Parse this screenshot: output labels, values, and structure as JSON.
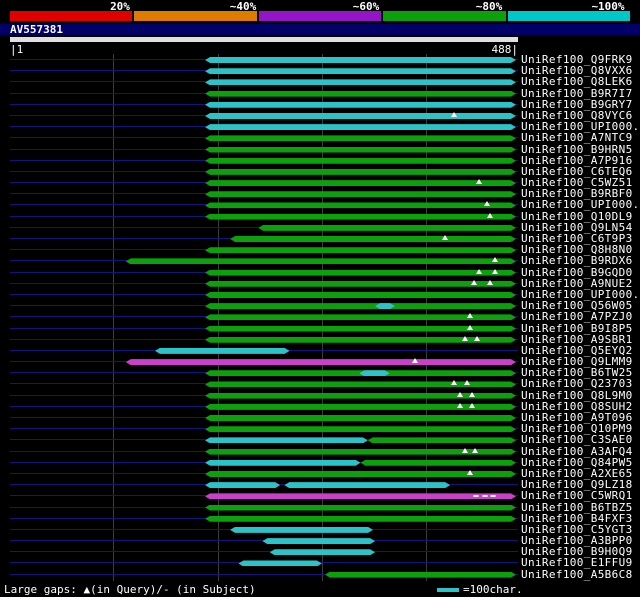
{
  "colors": {
    "cyan": "#2bc3c7",
    "green": "#0ca00c",
    "magenta": "#cc3fcc",
    "baseline": "#14147e",
    "grid": "#3c3c3c",
    "query_strip": "#000066",
    "query_bar": "#e0e0e0"
  },
  "query": {
    "name": "AV557381",
    "start_label": "|1",
    "end_label": "488|",
    "length": 488
  },
  "footer": {
    "gaps_label": "Large gaps: ▲(in Query)/- (in Subject)",
    "legend_text": "=100char."
  },
  "chart_data": {
    "type": "bar",
    "title": "AV557381",
    "x_axis": {
      "min": 1,
      "max": 488,
      "gridlines": [
        100,
        200,
        300,
        400
      ]
    },
    "legend": {
      "labels": [
        "20%",
        "~40%",
        "~60%",
        "~80%",
        "~100%"
      ],
      "colors": [
        "#e00000",
        "#de7b00",
        "#9414c8",
        "#0ca00c",
        "#00c8c8"
      ]
    },
    "rows": [
      {
        "label": "UniRef100_Q9FRK9",
        "segments": [
          {
            "start": 188,
            "end": 486,
            "color": "cyan"
          }
        ]
      },
      {
        "label": "UniRef100_Q8VXX6",
        "segments": [
          {
            "start": 188,
            "end": 486,
            "color": "cyan"
          }
        ]
      },
      {
        "label": "UniRef100_Q8LEK6",
        "segments": [
          {
            "start": 188,
            "end": 486,
            "color": "cyan"
          }
        ]
      },
      {
        "label": "UniRef100_B9R7I7",
        "segments": [
          {
            "start": 188,
            "end": 486,
            "color": "green"
          }
        ]
      },
      {
        "label": "UniRef100_B9GRY7",
        "segments": [
          {
            "start": 188,
            "end": 486,
            "color": "cyan"
          }
        ]
      },
      {
        "label": "UniRef100_Q8VYC6",
        "segments": [
          {
            "start": 188,
            "end": 486,
            "color": "cyan",
            "ticks": [
              427
            ]
          }
        ]
      },
      {
        "label": "UniRef100_UPI000..",
        "segments": [
          {
            "start": 188,
            "end": 486,
            "color": "cyan"
          }
        ]
      },
      {
        "label": "UniRef100_A7NTC9",
        "segments": [
          {
            "start": 188,
            "end": 486,
            "color": "green"
          }
        ]
      },
      {
        "label": "UniRef100_B9HRN5",
        "segments": [
          {
            "start": 188,
            "end": 486,
            "color": "green"
          }
        ]
      },
      {
        "label": "UniRef100_A7P916",
        "segments": [
          {
            "start": 188,
            "end": 486,
            "color": "green"
          }
        ]
      },
      {
        "label": "UniRef100_C6TEQ6",
        "segments": [
          {
            "start": 188,
            "end": 486,
            "color": "green"
          }
        ]
      },
      {
        "label": "UniRef100_C5WZ51",
        "segments": [
          {
            "start": 188,
            "end": 486,
            "color": "green",
            "ticks": [
              451
            ]
          }
        ]
      },
      {
        "label": "UniRef100_B9RBF0",
        "segments": [
          {
            "start": 188,
            "end": 486,
            "color": "green"
          }
        ]
      },
      {
        "label": "UniRef100_UPI000..",
        "segments": [
          {
            "start": 188,
            "end": 486,
            "color": "green",
            "ticks": [
              458
            ]
          }
        ]
      },
      {
        "label": "UniRef100_Q10DL9",
        "segments": [
          {
            "start": 188,
            "end": 486,
            "color": "green",
            "ticks": [
              461
            ]
          }
        ]
      },
      {
        "label": "UniRef100_Q9LN54",
        "segments": [
          {
            "start": 239,
            "end": 486,
            "color": "green"
          }
        ]
      },
      {
        "label": "UniRef100_C6T9P3",
        "segments": [
          {
            "start": 212,
            "end": 486,
            "color": "green",
            "ticks": [
              418
            ]
          }
        ]
      },
      {
        "label": "UniRef100_Q8H8N0",
        "segments": [
          {
            "start": 188,
            "end": 486,
            "color": "green"
          }
        ]
      },
      {
        "label": "UniRef100_B9RDX6",
        "segments": [
          {
            "start": 112,
            "end": 486,
            "color": "green",
            "ticks": [
              466
            ]
          }
        ]
      },
      {
        "label": "UniRef100_B9GQD0",
        "segments": [
          {
            "start": 188,
            "end": 486,
            "color": "green",
            "ticks": [
              451,
              466
            ]
          }
        ]
      },
      {
        "label": "UniRef100_A9NUE2",
        "segments": [
          {
            "start": 188,
            "end": 486,
            "color": "green",
            "ticks": [
              446,
              461
            ]
          }
        ]
      },
      {
        "label": "UniRef100_UPI000..",
        "segments": [
          {
            "start": 188,
            "end": 486,
            "color": "green"
          }
        ]
      },
      {
        "label": "UniRef100_Q56W05",
        "segments": [
          {
            "start": 188,
            "end": 486,
            "color": "green"
          },
          {
            "start": 351,
            "end": 370,
            "color": "cyan"
          }
        ]
      },
      {
        "label": "UniRef100_A7PZJ0",
        "segments": [
          {
            "start": 188,
            "end": 486,
            "color": "green",
            "ticks": [
              442
            ]
          }
        ]
      },
      {
        "label": "UniRef100_B9I8P5",
        "segments": [
          {
            "start": 188,
            "end": 486,
            "color": "green",
            "ticks": [
              442
            ]
          }
        ]
      },
      {
        "label": "UniRef100_A9SBR1",
        "segments": [
          {
            "start": 188,
            "end": 486,
            "color": "green",
            "ticks": [
              437,
              449
            ]
          }
        ]
      },
      {
        "label": "UniRef100_Q5EYQ2",
        "segments": [
          {
            "start": 140,
            "end": 269,
            "color": "cyan"
          }
        ]
      },
      {
        "label": "UniRef100_Q9LMM9",
        "segments": [
          {
            "start": 112,
            "end": 486,
            "color": "magenta",
            "ticks": [
              389
            ]
          }
        ]
      },
      {
        "label": "UniRef100_B6TW25",
        "segments": [
          {
            "start": 188,
            "end": 486,
            "color": "green"
          },
          {
            "start": 336,
            "end": 365,
            "color": "cyan"
          }
        ]
      },
      {
        "label": "UniRef100_Q23703",
        "segments": [
          {
            "start": 188,
            "end": 486,
            "color": "green",
            "ticks": [
              427,
              439
            ]
          }
        ]
      },
      {
        "label": "UniRef100_Q8L9M0",
        "segments": [
          {
            "start": 188,
            "end": 486,
            "color": "green",
            "ticks": [
              432,
              444
            ]
          }
        ]
      },
      {
        "label": "UniRef100_Q8SUH2",
        "segments": [
          {
            "start": 188,
            "end": 486,
            "color": "green",
            "ticks": [
              432,
              444
            ]
          }
        ]
      },
      {
        "label": "UniRef100_A9T096",
        "segments": [
          {
            "start": 188,
            "end": 486,
            "color": "green"
          }
        ]
      },
      {
        "label": "UniRef100_Q10PM9",
        "segments": [
          {
            "start": 188,
            "end": 486,
            "color": "green"
          }
        ]
      },
      {
        "label": "UniRef100_C3SAE0",
        "segments": [
          {
            "start": 188,
            "end": 344,
            "color": "cyan"
          },
          {
            "start": 344,
            "end": 486,
            "color": "green"
          }
        ]
      },
      {
        "label": "UniRef100_A3AFQ4",
        "segments": [
          {
            "start": 188,
            "end": 486,
            "color": "green",
            "ticks": [
              437,
              447
            ]
          }
        ]
      },
      {
        "label": "UniRef100_Q84PW5",
        "segments": [
          {
            "start": 188,
            "end": 337,
            "color": "cyan"
          },
          {
            "start": 337,
            "end": 486,
            "color": "green"
          }
        ]
      },
      {
        "label": "UniRef100_A2XE65",
        "segments": [
          {
            "start": 188,
            "end": 486,
            "color": "green",
            "ticks": [
              442
            ]
          }
        ]
      },
      {
        "label": "UniRef100_Q9LZ18",
        "segments": [
          {
            "start": 188,
            "end": 260,
            "color": "cyan"
          },
          {
            "start": 264,
            "end": 423,
            "color": "cyan"
          }
        ]
      },
      {
        "label": "UniRef100_C5WRQ1",
        "segments": [
          {
            "start": 188,
            "end": 486,
            "color": "magenta",
            "dashes": [
              448,
              456,
              464
            ]
          }
        ]
      },
      {
        "label": "UniRef100_B6TBZ5",
        "segments": [
          {
            "start": 188,
            "end": 486,
            "color": "green"
          }
        ]
      },
      {
        "label": "UniRef100_B4FXF3",
        "segments": [
          {
            "start": 188,
            "end": 486,
            "color": "green"
          }
        ]
      },
      {
        "label": "UniRef100_C5YGT3",
        "segments": [
          {
            "start": 212,
            "end": 349,
            "color": "cyan"
          }
        ]
      },
      {
        "label": "UniRef100_A3BPP0",
        "segments": [
          {
            "start": 243,
            "end": 351,
            "color": "cyan"
          }
        ]
      },
      {
        "label": "UniRef100_B9H0Q9",
        "segments": [
          {
            "start": 250,
            "end": 351,
            "color": "cyan"
          }
        ]
      },
      {
        "label": "UniRef100_E1FFU9",
        "segments": [
          {
            "start": 220,
            "end": 300,
            "color": "cyan"
          }
        ]
      },
      {
        "label": "UniRef100_A5B6C8",
        "segments": [
          {
            "start": 303,
            "end": 486,
            "color": "green"
          }
        ]
      }
    ]
  }
}
